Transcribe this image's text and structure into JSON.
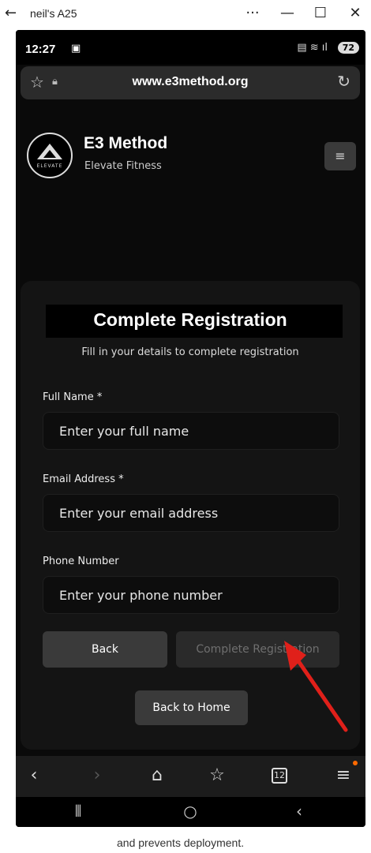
{
  "window": {
    "title": "neil's A25",
    "back_glyph": "←",
    "more_glyph": "···",
    "min_glyph": "—",
    "max_glyph": "☐",
    "close_glyph": "✕"
  },
  "status_bar": {
    "time": "12:27",
    "battery": "72"
  },
  "browser": {
    "url": "www.e3method.org"
  },
  "site": {
    "brand": "E3 Method",
    "tagline": "Elevate Fitness",
    "logo_text": "ELEVATE",
    "menu_glyph": "≡"
  },
  "form": {
    "title": "Complete Registration",
    "subtitle": "Fill in your details to complete registration",
    "fields": [
      {
        "label": "Full Name *",
        "placeholder": "Enter your full name"
      },
      {
        "label": "Email Address *",
        "placeholder": "Enter your email address"
      },
      {
        "label": "Phone Number",
        "placeholder": "Enter your phone number"
      }
    ],
    "back_label": "Back",
    "complete_label": "Complete Registration",
    "home_label": "Back to Home"
  },
  "browser_nav": {
    "tab_count": "12"
  },
  "below_text": "and prevents deployment.",
  "colors": {
    "page_bg": "#0a0a0a",
    "card_bg": "#141414",
    "button_bg": "#3a3a3a",
    "disabled_text": "#6f6f6f",
    "annotation_arrow": "#e0201a",
    "notification_dot": "#ff6a00"
  }
}
